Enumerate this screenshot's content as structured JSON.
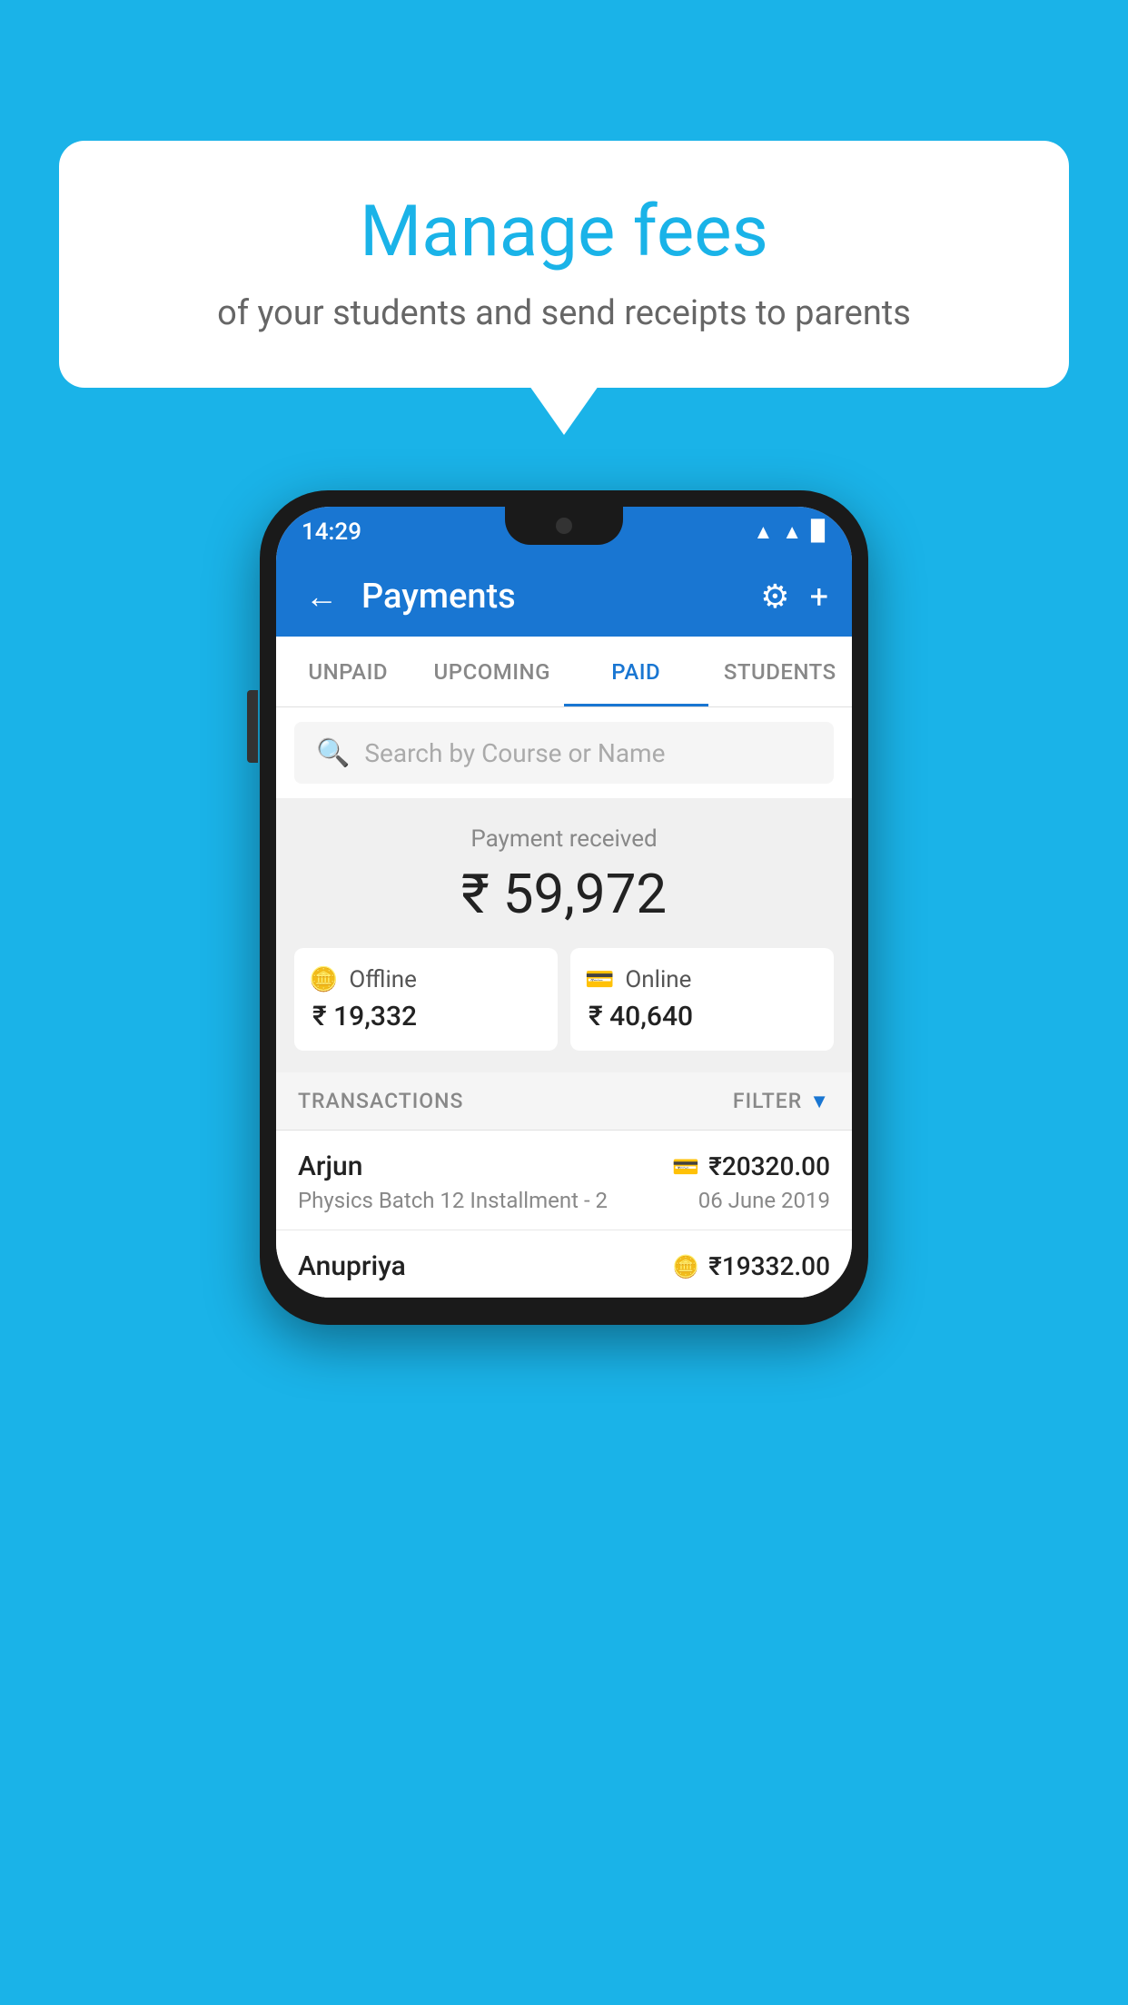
{
  "background_color": "#1ab3e8",
  "bubble": {
    "title": "Manage fees",
    "subtitle": "of your students and send receipts to parents"
  },
  "status_bar": {
    "time": "14:29",
    "wifi": "▲",
    "signal": "▲",
    "battery": "▉"
  },
  "app_bar": {
    "title": "Payments",
    "back_label": "←",
    "gear_label": "⚙",
    "plus_label": "+"
  },
  "tabs": [
    {
      "label": "UNPAID",
      "active": false
    },
    {
      "label": "UPCOMING",
      "active": false
    },
    {
      "label": "PAID",
      "active": true
    },
    {
      "label": "STUDENTS",
      "active": false
    }
  ],
  "search": {
    "placeholder": "Search by Course or Name"
  },
  "payment_summary": {
    "label": "Payment received",
    "amount": "₹ 59,972",
    "offline_label": "Offline",
    "offline_amount": "₹ 19,332",
    "online_label": "Online",
    "online_amount": "₹ 40,640"
  },
  "transactions": {
    "header_label": "TRANSACTIONS",
    "filter_label": "FILTER",
    "rows": [
      {
        "name": "Arjun",
        "amount": "₹20320.00",
        "description": "Physics Batch 12 Installment - 2",
        "date": "06 June 2019",
        "method": "card"
      },
      {
        "name": "Anupriya",
        "amount": "₹19332.00",
        "description": "",
        "date": "",
        "method": "cash"
      }
    ]
  }
}
